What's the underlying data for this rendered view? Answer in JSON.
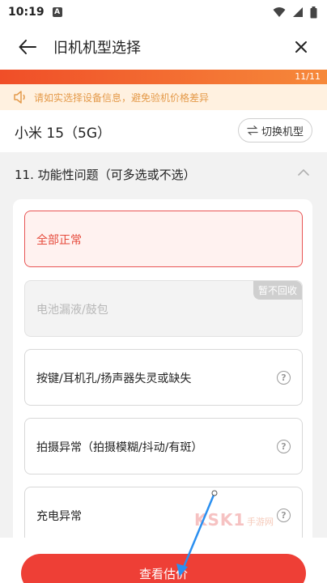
{
  "status_bar": {
    "time": "10:19",
    "notification_letter": "A"
  },
  "header": {
    "title": "旧机机型选择"
  },
  "progress": {
    "text": "11/11",
    "fraction": 1.0
  },
  "notice": {
    "text": "请如实选择设备信息，避免验机价格差异"
  },
  "model": {
    "name": "小米 15（5G）",
    "switch_label": "切换机型"
  },
  "section": {
    "title": "11. 功能性问题（可多选或不选）",
    "options": [
      {
        "label": "全部正常",
        "state": "selected"
      },
      {
        "label": "电池漏液/鼓包",
        "state": "disabled",
        "badge": "暂不回收"
      },
      {
        "label": "按键/耳机孔/扬声器失灵或缺失",
        "state": "normal"
      },
      {
        "label": "拍摄异常（拍摄模糊/抖动/有斑）",
        "state": "normal"
      },
      {
        "label": "充电异常",
        "state": "normal"
      }
    ]
  },
  "cta": {
    "label": "查看估价"
  },
  "watermark": {
    "text": "KSK1",
    "sub": "手游网"
  },
  "colors": {
    "accent": "#ee3f36",
    "notice_bg": "#fff1e0",
    "notice_text": "#e49a4a",
    "selected_border": "#e85454"
  }
}
